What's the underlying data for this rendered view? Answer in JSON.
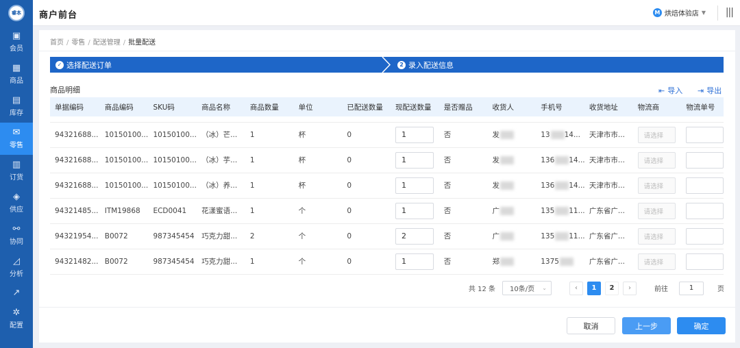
{
  "header": {
    "logo_text": "睿本",
    "app_title": "商户前台",
    "store_avatar": "M",
    "store_name": "烘焙体验店"
  },
  "sidebar": {
    "items": [
      {
        "label": "会员",
        "icon": "member-card-icon",
        "glyph": "▣",
        "active": false
      },
      {
        "label": "商品",
        "icon": "grid-icon",
        "glyph": "▦",
        "active": false
      },
      {
        "label": "库存",
        "icon": "warehouse-icon",
        "glyph": "▤",
        "active": false
      },
      {
        "label": "零售",
        "icon": "envelope-icon",
        "glyph": "✉",
        "active": true
      },
      {
        "label": "订货",
        "icon": "document-icon",
        "glyph": "▥",
        "active": false
      },
      {
        "label": "供应",
        "icon": "layers-icon",
        "glyph": "◈",
        "active": false
      },
      {
        "label": "协同",
        "icon": "share-icon",
        "glyph": "⚯",
        "active": false
      },
      {
        "label": "分析",
        "icon": "chart-icon",
        "glyph": "◿",
        "active": false
      },
      {
        "label": "",
        "icon": "trend-icon",
        "glyph": "↗",
        "active": false
      },
      {
        "label": "配置",
        "icon": "gear-icon",
        "glyph": "✲",
        "active": false
      }
    ]
  },
  "breadcrumb": [
    "首页",
    "零售",
    "配送管理",
    "批量配送"
  ],
  "steps": [
    {
      "icon": "check-icon",
      "glyph": "✓",
      "label": "选择配送订单"
    },
    {
      "icon": "step-two-icon",
      "glyph": "2",
      "label": "录入配送信息"
    }
  ],
  "section_title": "商品明细",
  "actions": {
    "import": "导入",
    "export": "导出"
  },
  "table": {
    "columns": [
      "单据编码",
      "商品编码",
      "SKU码",
      "商品名称",
      "商品数量",
      "单位",
      "已配送数量",
      "现配送数量",
      "是否赠品",
      "收货人",
      "手机号",
      "收货地址",
      "物流商",
      "物流单号"
    ],
    "select_placeholder": "请选择",
    "rows": [
      {
        "order": "94321688...",
        "code": "10150100...",
        "sku": "10150100...",
        "name": "（冰）芒...",
        "qty": "1",
        "unit": "杯",
        "shipped": "0",
        "ship_now": "1",
        "gift": "否",
        "receiver": "发",
        "phone_a": "13",
        "phone_b": "14...",
        "address": "天津市市..."
      },
      {
        "order": "94321688...",
        "code": "10150100...",
        "sku": "10150100...",
        "name": "（冰）芋...",
        "qty": "1",
        "unit": "杯",
        "shipped": "0",
        "ship_now": "1",
        "gift": "否",
        "receiver": "发",
        "phone_a": "136",
        "phone_b": "14...",
        "address": "天津市市..."
      },
      {
        "order": "94321688...",
        "code": "10150100...",
        "sku": "10150100...",
        "name": "（冰）养...",
        "qty": "1",
        "unit": "杯",
        "shipped": "0",
        "ship_now": "1",
        "gift": "否",
        "receiver": "发",
        "phone_a": "136",
        "phone_b": "14...",
        "address": "天津市市..."
      },
      {
        "order": "94321485...",
        "code": "ITM19868",
        "sku": "ECD0041",
        "name": "花漾蜜语...",
        "qty": "1",
        "unit": "个",
        "shipped": "0",
        "ship_now": "1",
        "gift": "否",
        "receiver": "广",
        "phone_a": "135",
        "phone_b": "11...",
        "address": "广东省广..."
      },
      {
        "order": "94321954...",
        "code": "B0072",
        "sku": "987345454",
        "name": "巧克力甜...",
        "qty": "2",
        "unit": "个",
        "shipped": "0",
        "ship_now": "2",
        "gift": "否",
        "receiver": "广",
        "phone_a": "135",
        "phone_b": "11...",
        "address": "广东省广..."
      },
      {
        "order": "94321482...",
        "code": "B0072",
        "sku": "987345454",
        "name": "巧克力甜...",
        "qty": "1",
        "unit": "个",
        "shipped": "0",
        "ship_now": "1",
        "gift": "否",
        "receiver": "郑",
        "phone_a": "1375",
        "phone_b": "",
        "address": "广东省广..."
      }
    ]
  },
  "pagination": {
    "total": "共 12 条",
    "page_size": "10条/页",
    "prev": "‹",
    "pages": [
      "1",
      "2"
    ],
    "current": "1",
    "next": "›",
    "goto_label": "前往",
    "goto_value": "1",
    "page_suffix": "页"
  },
  "footer": {
    "cancel": "取消",
    "prev": "上一步",
    "confirm": "确定"
  },
  "colors": {
    "primary": "#2d8cf0",
    "sidebar": "#1e5fae",
    "step_bar": "#1e66c8",
    "header_row": "#eaf3fd"
  }
}
